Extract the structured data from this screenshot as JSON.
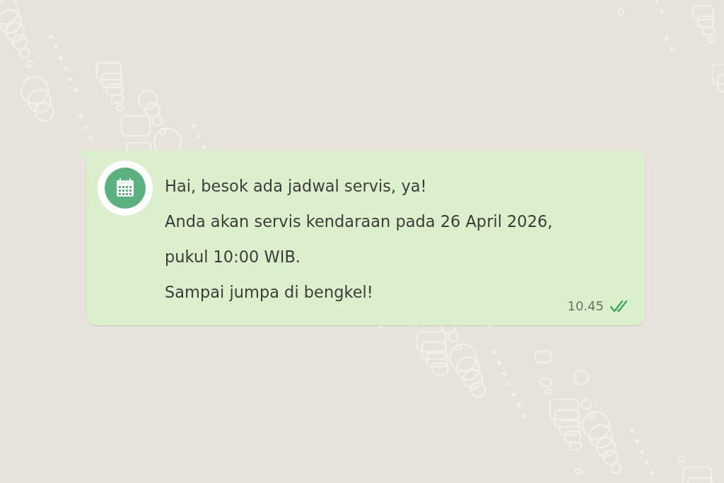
{
  "message": {
    "lines": [
      "Hai, besok ada jadwal servis, ya!",
      "Anda akan servis kendaraan pada 26 April 2026,",
      "pukul 10:00 WIB.",
      "Sampai jumpa di bengkel!"
    ],
    "time": "10.45",
    "read": true
  }
}
